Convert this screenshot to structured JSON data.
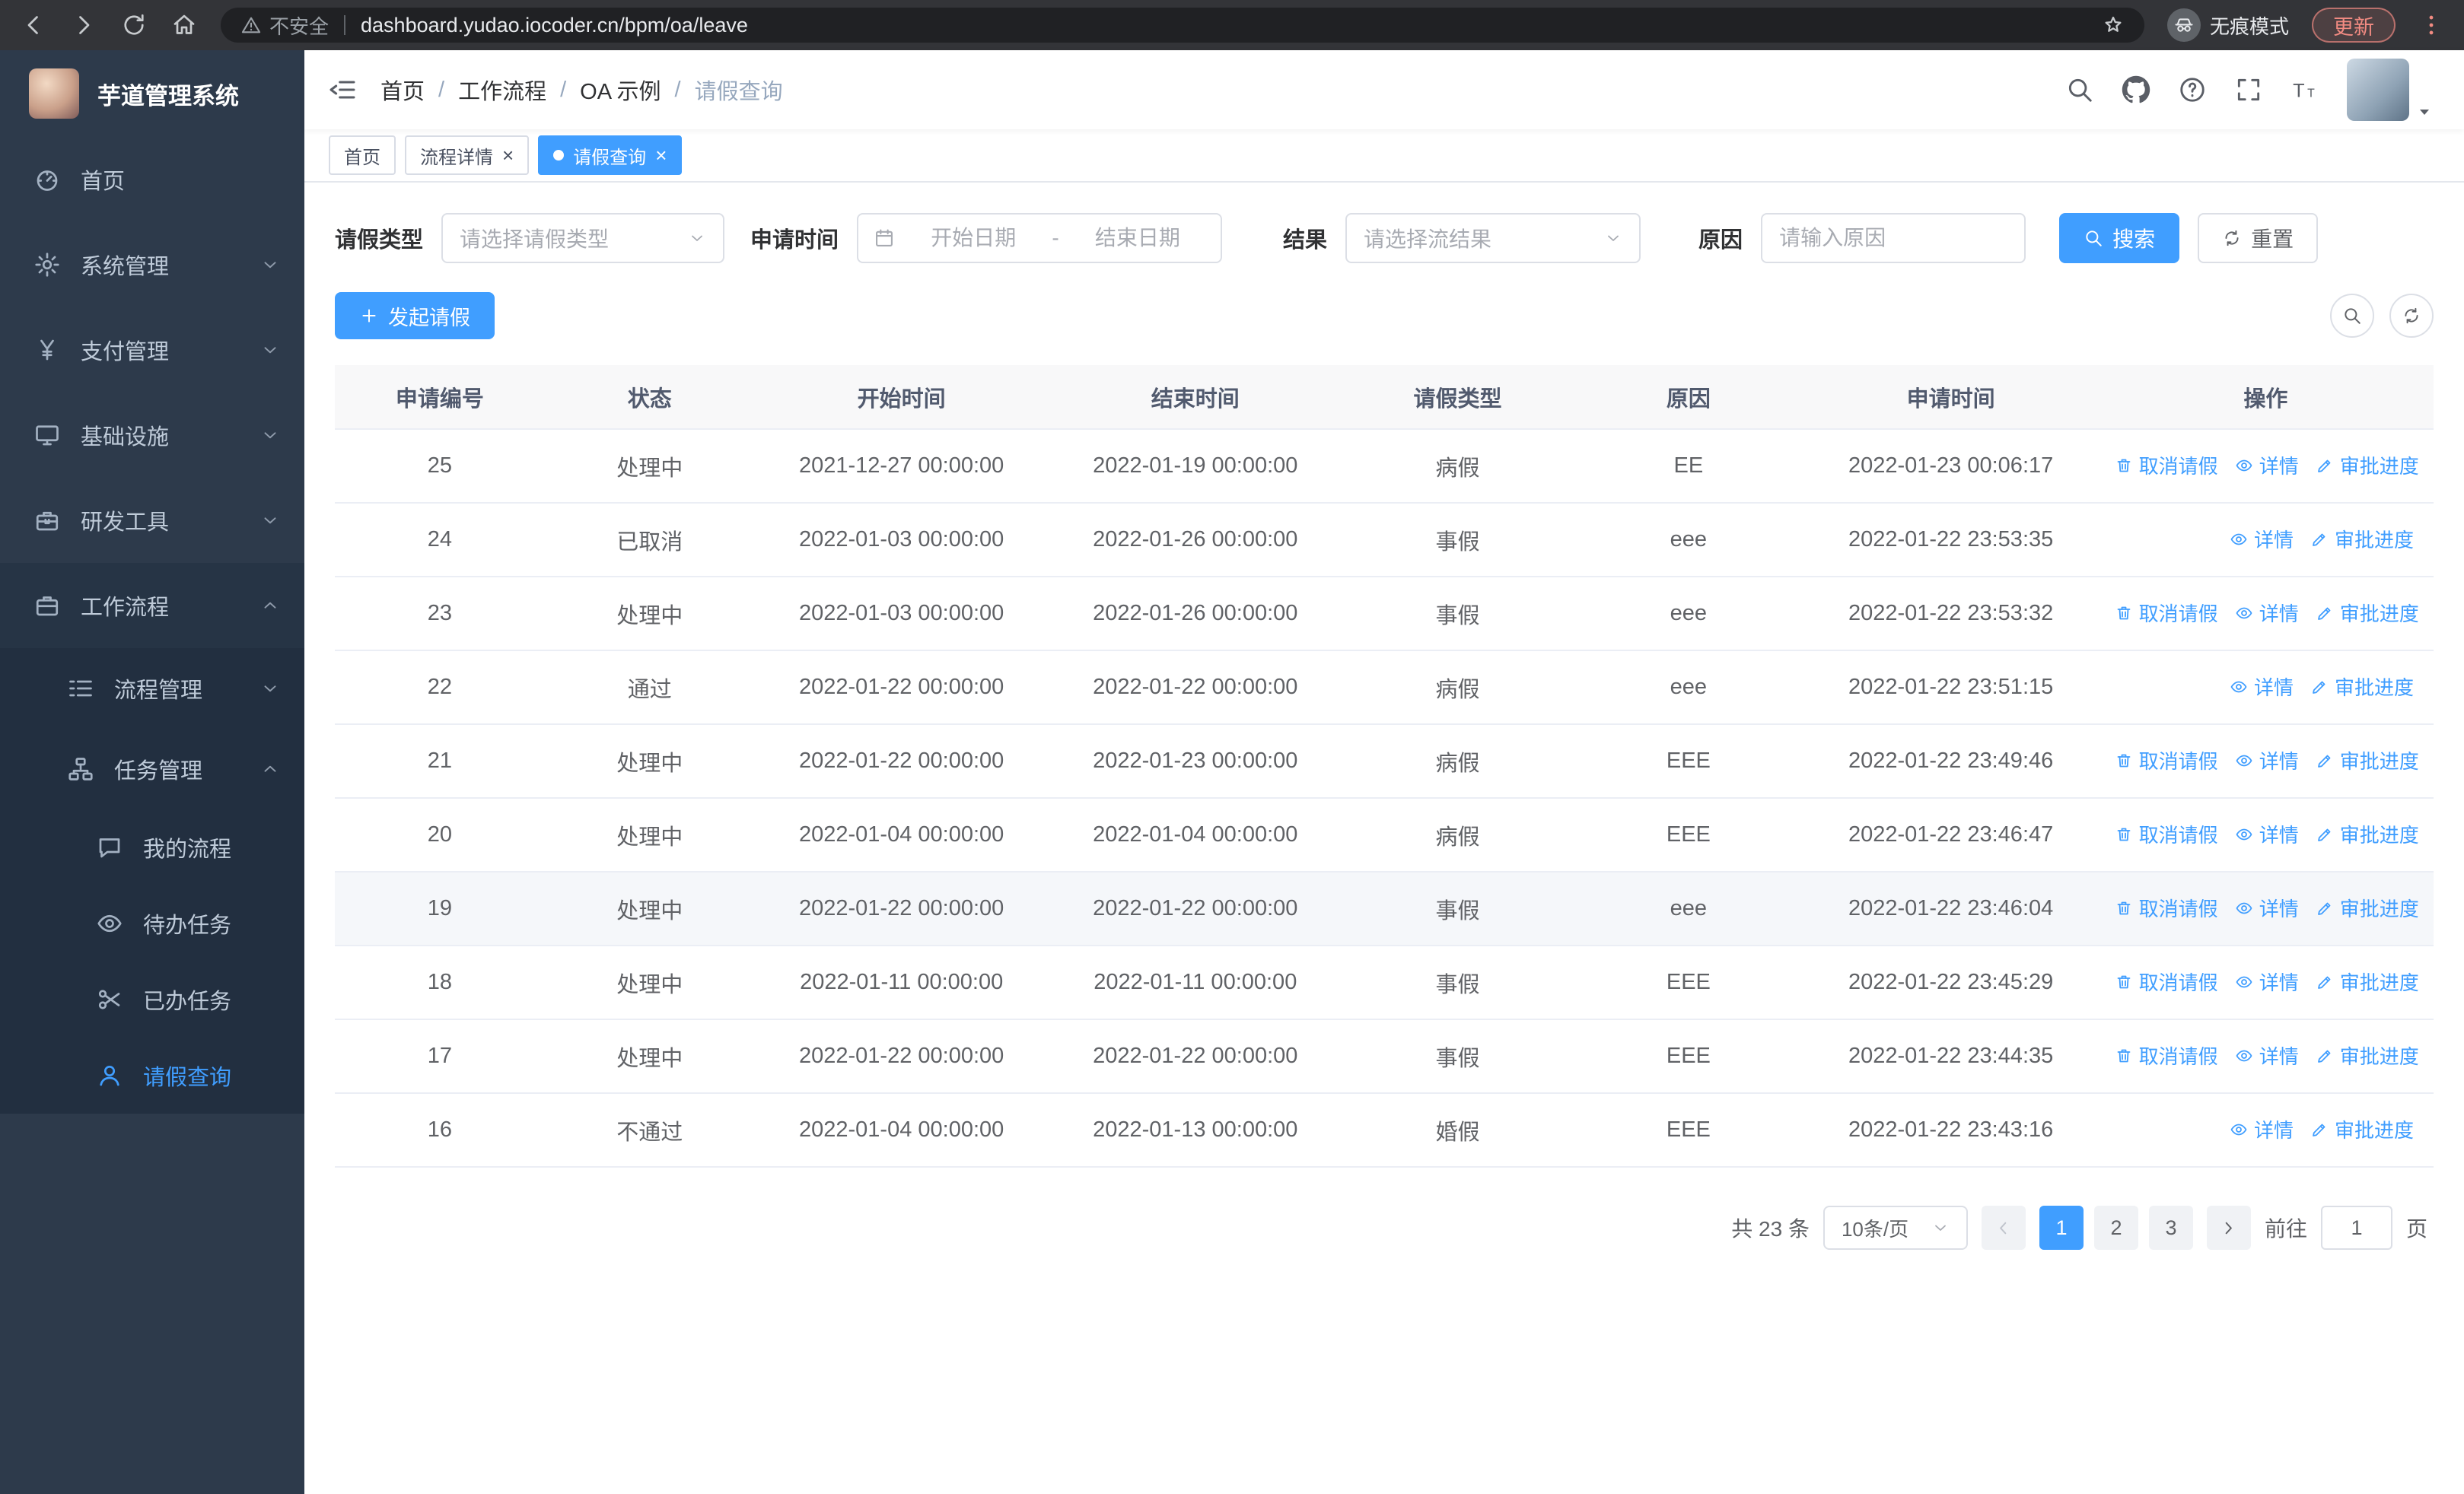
{
  "colors": {
    "accent": "#409eff",
    "sidebar_bg": "#2d3a4b",
    "submenu_bg": "#222f40",
    "update_chip": "#f28b82"
  },
  "browser": {
    "url": "dashboard.yudao.iocoder.cn/bpm/oa/leave",
    "security_label": "不安全",
    "incognito_label": "无痕模式",
    "update_label": "更新"
  },
  "sidebar": {
    "logo_title": "芋道管理系统",
    "items": [
      {
        "label": "首页",
        "icon": "dashboard"
      },
      {
        "label": "系统管理",
        "icon": "gear"
      },
      {
        "label": "支付管理",
        "icon": "yen"
      },
      {
        "label": "基础设施",
        "icon": "monitor"
      },
      {
        "label": "研发工具",
        "icon": "toolbox"
      },
      {
        "label": "工作流程",
        "icon": "briefcase"
      }
    ],
    "submenu": [
      {
        "label": "流程管理",
        "icon": "flowlist"
      },
      {
        "label": "任务管理",
        "icon": "orgchart"
      }
    ],
    "task_items": [
      {
        "label": "我的流程",
        "icon": "chat"
      },
      {
        "label": "待办任务",
        "icon": "eye"
      },
      {
        "label": "已办任务",
        "icon": "scissors"
      },
      {
        "label": "请假查询",
        "icon": "user",
        "active": true
      }
    ]
  },
  "header": {
    "breadcrumb": [
      "首页",
      "工作流程",
      "OA 示例",
      "请假查询"
    ]
  },
  "tabs": [
    {
      "label": "首页"
    },
    {
      "label": "流程详情",
      "close": "×"
    },
    {
      "label": "请假查询",
      "close": "×",
      "active": true
    }
  ],
  "filters": {
    "type_label": "请假类型",
    "type_placeholder": "请选择请假类型",
    "time_label": "申请时间",
    "time_start_placeholder": "开始日期",
    "time_separator": "-",
    "time_end_placeholder": "结束日期",
    "result_label": "结果",
    "result_placeholder": "请选择流结果",
    "reason_label": "原因",
    "reason_placeholder": "请输入原因",
    "search_label": "搜索",
    "reset_label": "重置"
  },
  "toolbar": {
    "create_label": "发起请假"
  },
  "table": {
    "columns": [
      "申请编号",
      "状态",
      "开始时间",
      "结束时间",
      "请假类型",
      "原因",
      "申请时间",
      "操作"
    ],
    "action_labels": {
      "cancel": "取消请假",
      "detail": "详情",
      "progress": "审批进度"
    },
    "rows": [
      {
        "id": "25",
        "status": "处理中",
        "start": "2021-12-27 00:00:00",
        "end": "2022-01-19 00:00:00",
        "type": "病假",
        "reason": "EE",
        "apply": "2022-01-23 00:06:17",
        "actions": [
          "cancel",
          "detail",
          "progress"
        ]
      },
      {
        "id": "24",
        "status": "已取消",
        "start": "2022-01-03 00:00:00",
        "end": "2022-01-26 00:00:00",
        "type": "事假",
        "reason": "eee",
        "apply": "2022-01-22 23:53:35",
        "actions": [
          "detail",
          "progress"
        ]
      },
      {
        "id": "23",
        "status": "处理中",
        "start": "2022-01-03 00:00:00",
        "end": "2022-01-26 00:00:00",
        "type": "事假",
        "reason": "eee",
        "apply": "2022-01-22 23:53:32",
        "actions": [
          "cancel",
          "detail",
          "progress"
        ]
      },
      {
        "id": "22",
        "status": "通过",
        "start": "2022-01-22 00:00:00",
        "end": "2022-01-22 00:00:00",
        "type": "病假",
        "reason": "eee",
        "apply": "2022-01-22 23:51:15",
        "actions": [
          "detail",
          "progress"
        ]
      },
      {
        "id": "21",
        "status": "处理中",
        "start": "2022-01-22 00:00:00",
        "end": "2022-01-23 00:00:00",
        "type": "病假",
        "reason": "EEE",
        "apply": "2022-01-22 23:49:46",
        "actions": [
          "cancel",
          "detail",
          "progress"
        ]
      },
      {
        "id": "20",
        "status": "处理中",
        "start": "2022-01-04 00:00:00",
        "end": "2022-01-04 00:00:00",
        "type": "病假",
        "reason": "EEE",
        "apply": "2022-01-22 23:46:47",
        "actions": [
          "cancel",
          "detail",
          "progress"
        ]
      },
      {
        "id": "19",
        "status": "处理中",
        "start": "2022-01-22 00:00:00",
        "end": "2022-01-22 00:00:00",
        "type": "事假",
        "reason": "eee",
        "apply": "2022-01-22 23:46:04",
        "actions": [
          "cancel",
          "detail",
          "progress"
        ],
        "highlight": true
      },
      {
        "id": "18",
        "status": "处理中",
        "start": "2022-01-11 00:00:00",
        "end": "2022-01-11 00:00:00",
        "type": "事假",
        "reason": "EEE",
        "apply": "2022-01-22 23:45:29",
        "actions": [
          "cancel",
          "detail",
          "progress"
        ]
      },
      {
        "id": "17",
        "status": "处理中",
        "start": "2022-01-22 00:00:00",
        "end": "2022-01-22 00:00:00",
        "type": "事假",
        "reason": "EEE",
        "apply": "2022-01-22 23:44:35",
        "actions": [
          "cancel",
          "detail",
          "progress"
        ]
      },
      {
        "id": "16",
        "status": "不通过",
        "start": "2022-01-04 00:00:00",
        "end": "2022-01-13 00:00:00",
        "type": "婚假",
        "reason": "EEE",
        "apply": "2022-01-22 23:43:16",
        "actions": [
          "detail",
          "progress"
        ]
      }
    ]
  },
  "pagination": {
    "total_label": "共 23 条",
    "page_size": "10条/页",
    "pages": [
      "1",
      "2",
      "3"
    ],
    "active_page": "1",
    "goto_label": "前往",
    "goto_value": "1",
    "goto_suffix": "页"
  }
}
